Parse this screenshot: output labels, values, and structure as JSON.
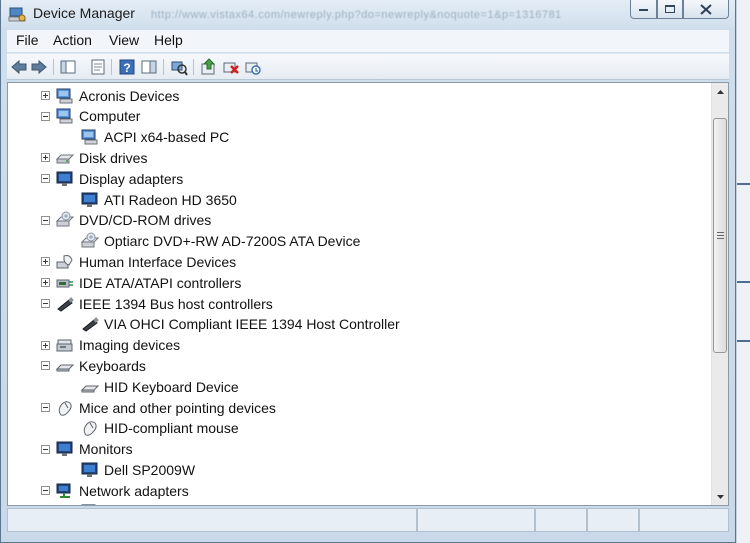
{
  "window": {
    "title": "Device Manager",
    "url_hint": "http://www.vistax64.com/newreply.php?do=newreply&noquote=1&p=1316781"
  },
  "menu": [
    "File",
    "Action",
    "View",
    "Help"
  ],
  "toolbar": {
    "icons": [
      "back-arrow-icon",
      "forward-arrow-icon",
      "show-hide-console-tree-icon",
      "properties-icon",
      "help-icon",
      "show-action-pane-icon",
      "scan-hardware-icon",
      "update-driver-icon",
      "disable-device-icon",
      "uninstall-device-icon"
    ]
  },
  "tree": [
    {
      "label": "Acronis Devices",
      "level": 0,
      "expanded": false,
      "icon": "computer-icon"
    },
    {
      "label": "Computer",
      "level": 0,
      "expanded": true,
      "icon": "computer-icon"
    },
    {
      "label": "ACPI x64-based PC",
      "level": 1,
      "icon": "computer-icon"
    },
    {
      "label": "Disk drives",
      "level": 0,
      "expanded": false,
      "icon": "disk-drive-icon"
    },
    {
      "label": "Display adapters",
      "level": 0,
      "expanded": true,
      "icon": "monitor-icon"
    },
    {
      "label": "ATI Radeon HD 3650",
      "level": 1,
      "icon": "monitor-icon"
    },
    {
      "label": "DVD/CD-ROM drives",
      "level": 0,
      "expanded": true,
      "icon": "dvd-drive-icon"
    },
    {
      "label": "Optiarc DVD+-RW AD-7200S ATA Device",
      "level": 1,
      "icon": "dvd-drive-icon"
    },
    {
      "label": "Human Interface Devices",
      "level": 0,
      "expanded": false,
      "icon": "hid-icon"
    },
    {
      "label": "IDE ATA/ATAPI controllers",
      "level": 0,
      "expanded": false,
      "icon": "ide-controller-icon"
    },
    {
      "label": "IEEE 1394 Bus host controllers",
      "level": 0,
      "expanded": true,
      "icon": "firewire-icon"
    },
    {
      "label": "VIA OHCI Compliant IEEE 1394 Host Controller",
      "level": 1,
      "icon": "firewire-icon"
    },
    {
      "label": "Imaging devices",
      "level": 0,
      "expanded": false,
      "icon": "scanner-icon"
    },
    {
      "label": "Keyboards",
      "level": 0,
      "expanded": true,
      "icon": "keyboard-icon"
    },
    {
      "label": "HID Keyboard Device",
      "level": 1,
      "icon": "keyboard-icon"
    },
    {
      "label": "Mice and other pointing devices",
      "level": 0,
      "expanded": true,
      "icon": "mouse-icon"
    },
    {
      "label": "HID-compliant mouse",
      "level": 1,
      "icon": "mouse-icon"
    },
    {
      "label": "Monitors",
      "level": 0,
      "expanded": true,
      "icon": "monitor-icon"
    },
    {
      "label": "Dell SP2009W",
      "level": 1,
      "icon": "monitor-icon"
    },
    {
      "label": "Network adapters",
      "level": 0,
      "expanded": true,
      "icon": "network-icon"
    }
  ],
  "colors": {
    "accent": "#2f5f9e",
    "title_bg": "#cfdeec",
    "content_bg": "#ffffff"
  }
}
